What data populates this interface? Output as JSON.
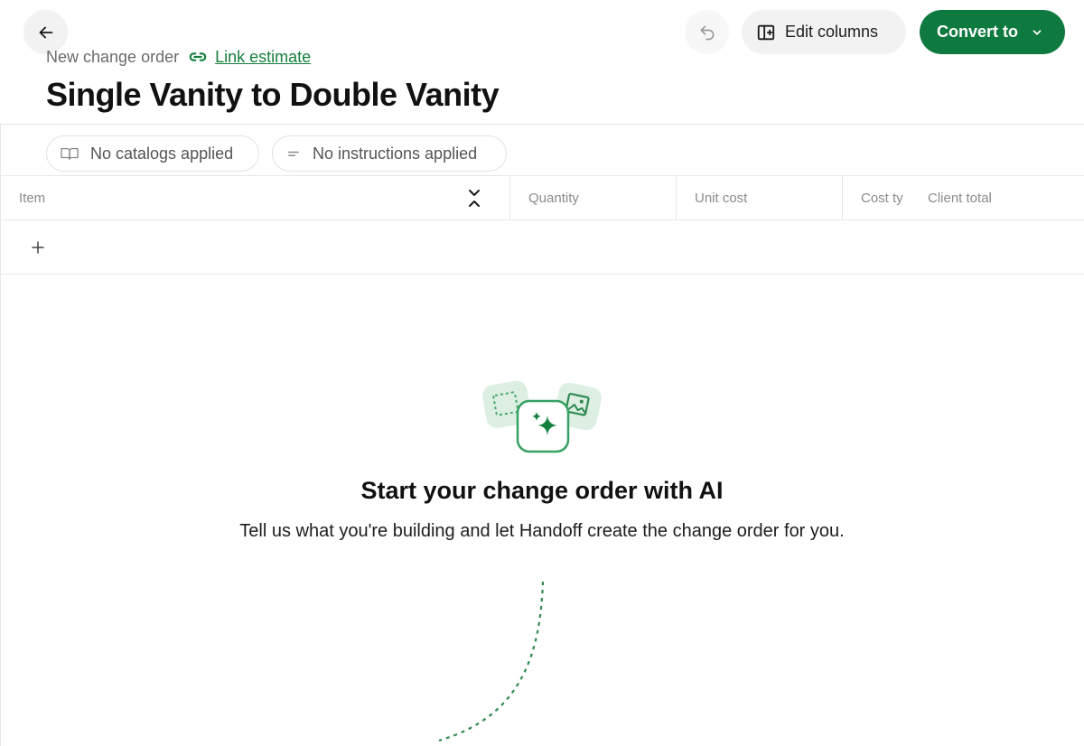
{
  "header": {
    "subtitle": "New change order",
    "link_label": "Link estimate",
    "title": "Single Vanity to Double Vanity",
    "edit_columns_label": "Edit columns",
    "convert_label": "Convert to"
  },
  "filters": {
    "catalogs_label": "No catalogs applied",
    "instructions_label": "No instructions applied"
  },
  "table": {
    "columns": [
      "Item",
      "Quantity",
      "Unit cost",
      "Cost ty",
      "Client total"
    ]
  },
  "empty_state": {
    "title": "Start your change order with AI",
    "description": "Tell us what you're building and let Handoff create the change order for you."
  },
  "colors": {
    "accent": "#0f7a3f",
    "link": "#15803d"
  },
  "icons": [
    "arrow-left-icon",
    "undo-icon",
    "columns-icon",
    "chevron-down-icon",
    "link-icon",
    "book-icon",
    "text-lines-icon",
    "sort-icon",
    "plus-icon",
    "sparkle-icon"
  ]
}
